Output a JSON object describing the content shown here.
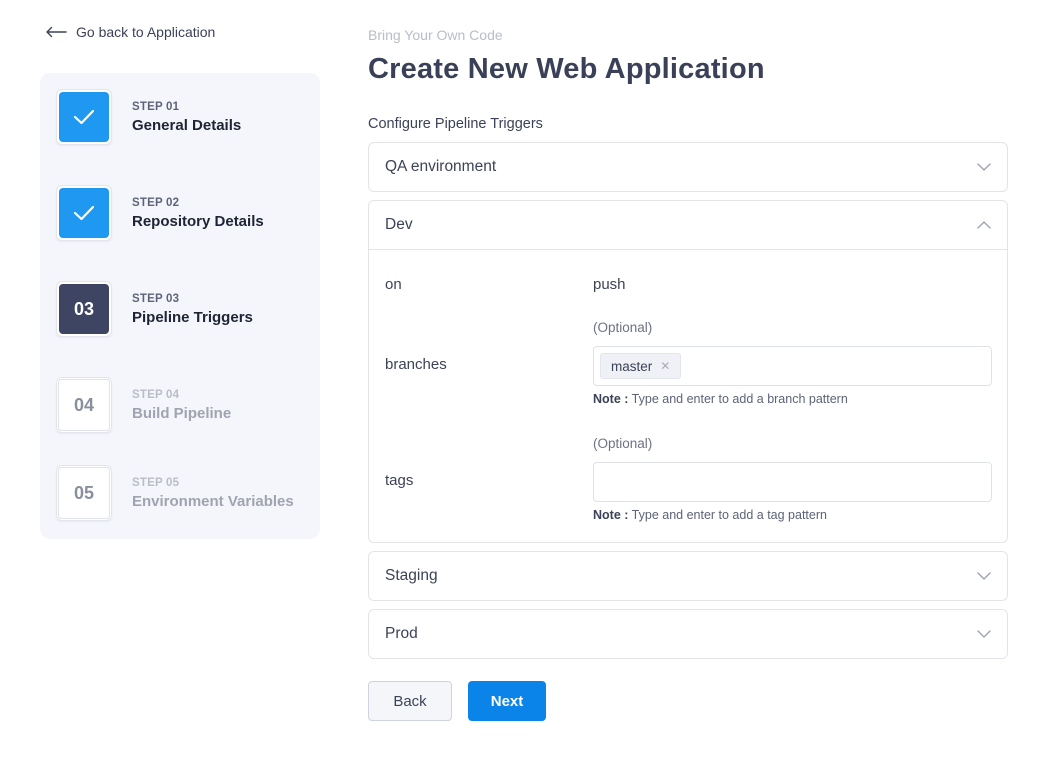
{
  "nav": {
    "back_label": "Go back to Application"
  },
  "header": {
    "subtitle": "Bring Your Own Code",
    "title": "Create New Web Application"
  },
  "stepper": {
    "steps": [
      {
        "number_label": "STEP 01",
        "title": "General Details",
        "status": "completed",
        "badge": ""
      },
      {
        "number_label": "STEP 02",
        "title": "Repository Details",
        "status": "completed",
        "badge": ""
      },
      {
        "number_label": "STEP 03",
        "title": "Pipeline Triggers",
        "status": "current",
        "badge": "03"
      },
      {
        "number_label": "STEP 04",
        "title": "Build Pipeline",
        "status": "pending",
        "badge": "04"
      },
      {
        "number_label": "STEP 05",
        "title": "Environment Variables",
        "status": "pending",
        "badge": "05"
      }
    ]
  },
  "main": {
    "section_label": "Configure Pipeline Triggers",
    "panels": {
      "qa": {
        "title": "QA environment",
        "expanded": false
      },
      "dev": {
        "title": "Dev",
        "expanded": true,
        "on_label": "on",
        "on_value": "push",
        "branches_label": "branches",
        "branches_optional": "(Optional)",
        "branches_chip": "master",
        "branches_note_prefix": "Note :",
        "branches_note": "Type and enter to add a branch pattern",
        "tags_label": "tags",
        "tags_optional": "(Optional)",
        "tags_note_prefix": "Note :",
        "tags_note": "Type and enter to add a tag pattern"
      },
      "staging": {
        "title": "Staging",
        "expanded": false
      },
      "prod": {
        "title": "Prod",
        "expanded": false
      }
    }
  },
  "actions": {
    "back_label": "Back",
    "next_label": "Next"
  },
  "colors": {
    "primary": "#0a84e8",
    "completed": "#1e98f1",
    "current": "#3e4563",
    "stepper_bg": "#f5f6fb"
  },
  "icons": {
    "back": "arrow-left-icon",
    "completed": "check-icon",
    "collapsed": "chevron-down-icon",
    "expanded": "chevron-up-icon",
    "chip_remove": "close-icon"
  }
}
